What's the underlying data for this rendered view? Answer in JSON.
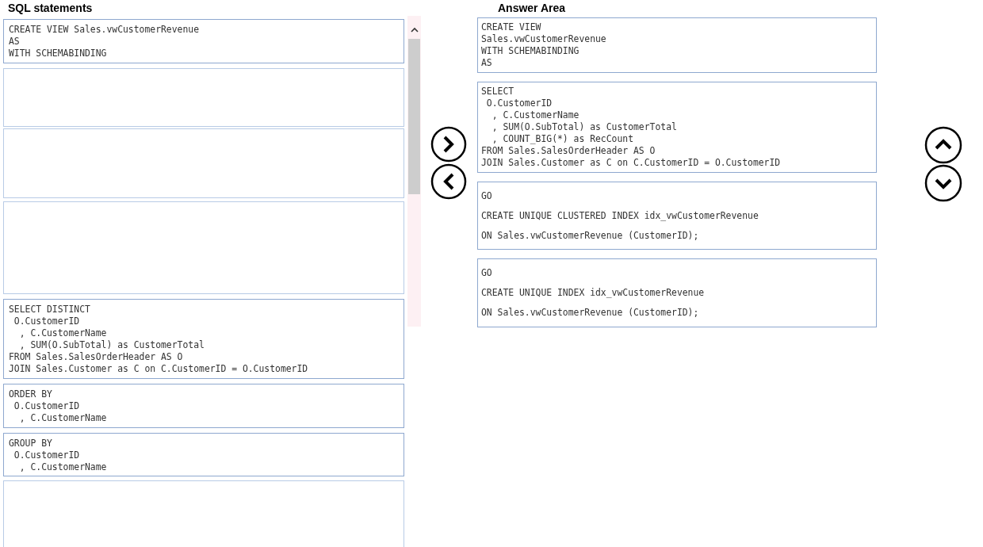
{
  "sql_statements": {
    "title": "SQL statements",
    "items": [
      {
        "kind": "statement",
        "lines": [
          "CREATE VIEW Sales.vwCustomerRevenue",
          "AS",
          "WITH SCHEMABINDING"
        ]
      },
      {
        "kind": "empty"
      },
      {
        "kind": "empty"
      },
      {
        "kind": "empty"
      },
      {
        "kind": "statement",
        "lines": [
          "SELECT DISTINCT",
          " O.CustomerID",
          "  , C.CustomerName",
          "  , SUM(O.SubTotal) as CustomerTotal",
          "FROM Sales.SalesOrderHeader AS O",
          "JOIN Sales.Customer as C on C.CustomerID = O.CustomerID"
        ]
      },
      {
        "kind": "statement",
        "lines": [
          "ORDER BY",
          " O.CustomerID",
          "  , C.CustomerName"
        ]
      },
      {
        "kind": "statement",
        "lines": [
          "GROUP BY",
          " O.CustomerID",
          "  , C.CustomerName"
        ]
      },
      {
        "kind": "empty"
      }
    ]
  },
  "answer_area": {
    "title": "Answer Area",
    "items": [
      {
        "kind": "compact",
        "lines": [
          "CREATE VIEW",
          "Sales.vwCustomerRevenue",
          "WITH SCHEMABINDING",
          "AS"
        ]
      },
      {
        "kind": "compact",
        "lines": [
          "SELECT",
          " O.CustomerID",
          "  , C.CustomerName",
          "  , SUM(O.SubTotal) as CustomerTotal",
          "  , COUNT_BIG(*) as RecCount",
          "FROM Sales.SalesOrderHeader AS O",
          "JOIN Sales.Customer as C on C.CustomerID = O.CustomerID"
        ]
      },
      {
        "kind": "spaced",
        "lines": [
          "GO",
          "CREATE UNIQUE CLUSTERED INDEX idx_vwCustomerRevenue",
          "ON Sales.vwCustomerRevenue (CustomerID);"
        ]
      },
      {
        "kind": "spaced",
        "lines": [
          "GO",
          "CREATE UNIQUE INDEX idx_vwCustomerRevenue",
          "ON Sales.vwCustomerRevenue (CustomerID);"
        ]
      }
    ]
  }
}
